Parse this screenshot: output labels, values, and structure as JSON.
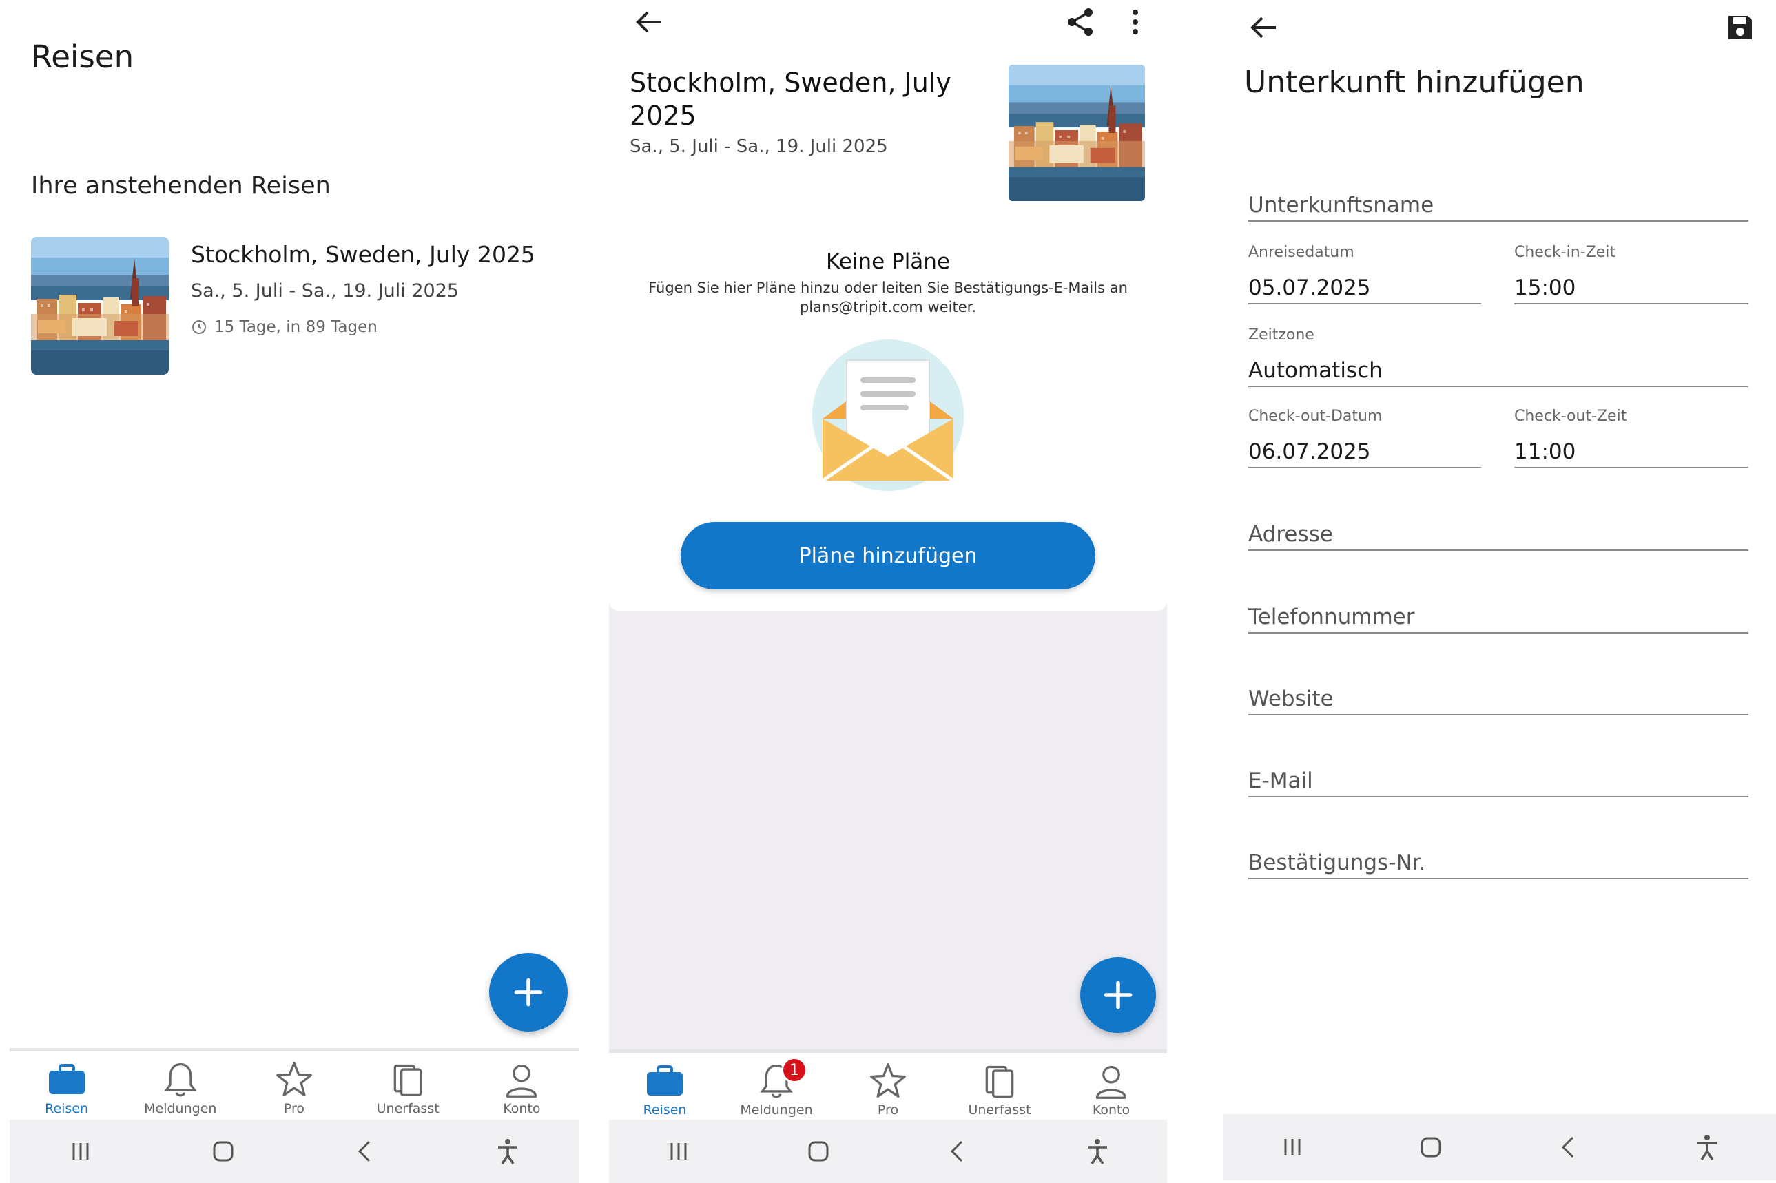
{
  "panel1": {
    "title": "Reisen",
    "section_title": "Ihre anstehenden Reisen",
    "trip": {
      "name": "Stockholm, Sweden, July 2025",
      "dates": "Sa., 5. Juli - Sa., 19. Juli 2025",
      "meta": "15 Tage, in 89 Tagen"
    }
  },
  "panel2": {
    "trip_title": "Stockholm, Sweden, July 2025",
    "dates": "Sa., 5. Juli - Sa., 19. Juli 2025",
    "empty_title": "Keine Pläne",
    "empty_text": "Fügen Sie hier Pläne hinzu oder leiten Sie Bestätigungs-E-Mails an plans@tripit.com weiter.",
    "add_button": "Pläne hinzufügen",
    "notification_badge": "1"
  },
  "panel3": {
    "title": "Unterkunft hinzufügen",
    "fields": {
      "name_placeholder": "Unterkunftsname",
      "checkin_date_label": "Anreisedatum",
      "checkin_date_value": "05.07.2025",
      "checkin_time_label": "Check-in-Zeit",
      "checkin_time_value": "15:00",
      "timezone_label": "Zeitzone",
      "timezone_value": "Automatisch",
      "checkout_date_label": "Check-out-Datum",
      "checkout_date_value": "06.07.2025",
      "checkout_time_label": "Check-out-Zeit",
      "checkout_time_value": "11:00",
      "address_placeholder": "Adresse",
      "phone_placeholder": "Telefonnummer",
      "website_placeholder": "Website",
      "email_placeholder": "E-Mail",
      "confirmation_placeholder": "Bestätigungs-Nr."
    }
  },
  "nav": {
    "reisen": "Reisen",
    "meldungen": "Meldungen",
    "pro": "Pro",
    "unerfasst": "Unerfasst",
    "konto": "Konto"
  },
  "icons": [
    "briefcase-icon",
    "bell-icon",
    "star-icon",
    "documents-icon",
    "person-icon",
    "plus-icon",
    "back-arrow-icon",
    "share-icon",
    "more-vert-icon",
    "save-icon",
    "clock-icon",
    "envelope-icon",
    "recents-icon",
    "home-icon",
    "system-back-icon",
    "accessibility-icon"
  ],
  "colors": {
    "accent": "#1377c9",
    "badge": "#d8121b",
    "grey_bg": "#efedf2"
  }
}
